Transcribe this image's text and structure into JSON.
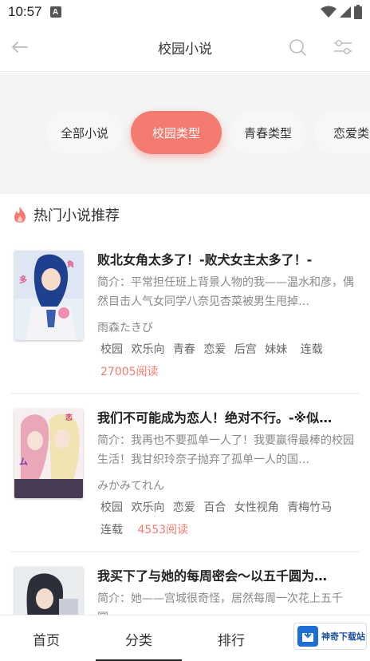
{
  "status": {
    "time": "10:57",
    "notification": "A"
  },
  "header": {
    "title": "校园小说"
  },
  "tabs": [
    {
      "label": "全部小说"
    },
    {
      "label": "校园类型"
    },
    {
      "label": "青春类型"
    },
    {
      "label": "恋爱类"
    }
  ],
  "section": {
    "title": "热门小说推荐"
  },
  "books": [
    {
      "title": "败北女角太多了！-败犬女主太多了！-",
      "intro": "简介：平常担任班上背景人物的我——温水和彦，偶然目击人气女同学八奈见杏菜被男生甩掉…",
      "author": "雨森たきび",
      "tags": [
        "校园",
        "欢乐向",
        "青春",
        "恋爱",
        "后宫",
        "妹妹",
        "连载"
      ],
      "reads": "27005阅读"
    },
    {
      "title": "我们不可能成为恋人！绝对不行。-※似…",
      "intro": "简介：我再也不要孤单一人了！我要赢得最棒的校园生活！我甘织玲奈子抛弃了孤单一人的国…",
      "author": "みかみてれん",
      "tags": [
        "校园",
        "欢乐向",
        "恋爱",
        "百合",
        "女性视角",
        "青梅竹马",
        "连载"
      ],
      "reads": "4553阅读"
    },
    {
      "title": "我买下了与她的每周密会～以五千圆为…",
      "intro": "简介：她——宫城很奇怪，居然每周一次花上五千圆……"
    }
  ],
  "nav": [
    {
      "label": "首页"
    },
    {
      "label": "分类"
    },
    {
      "label": "排行"
    }
  ],
  "watermark": {
    "text": "神奇下载站"
  },
  "colors": {
    "accent": "#f47b70",
    "background": "#f4f4f4"
  }
}
